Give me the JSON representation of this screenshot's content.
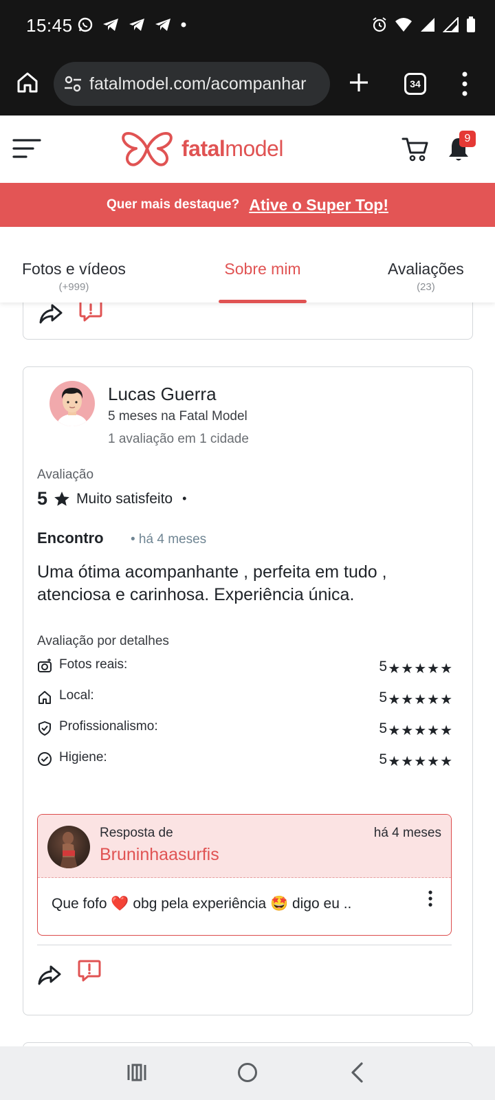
{
  "status_bar": {
    "time": "15:45"
  },
  "browser": {
    "url": "fatalmodel.com/acompanhar",
    "tab_count": "34"
  },
  "header": {
    "brand_bold": "fatal",
    "brand_light": "model",
    "notification_count": "9"
  },
  "promo": {
    "question": "Quer mais destaque?",
    "cta": "Ative o Super Top!"
  },
  "tabs": [
    {
      "label": "Fotos e vídeos",
      "count": "(+999)"
    },
    {
      "label": "Sobre mim",
      "count": ""
    },
    {
      "label": "Avaliações",
      "count": "(23)"
    }
  ],
  "active_tab": "Sobre mim",
  "review": {
    "user_name": "Lucas Guerra",
    "member_since": "5 meses na Fatal Model",
    "review_count": "1 avaliação em 1 cidade",
    "rating_label": "Avaliação",
    "rating_value": "5",
    "rating_star": "★",
    "rating_text": "Muito satisfeito",
    "dot": "•",
    "type": "Encontro",
    "time": "• há 4 meses",
    "text": "Uma ótima acompanhante , perfeita em tudo , atenciosa e carinhosa. Experiência única.",
    "details_title": "Avaliação por detalhes",
    "details": [
      {
        "icon": "camera-icon",
        "label": "Fotos reais:",
        "value": "5",
        "stars": "★★★★★"
      },
      {
        "icon": "house-icon",
        "label": "Local:",
        "value": "5",
        "stars": "★★★★★"
      },
      {
        "icon": "shield-check-icon",
        "label": "Profissionalismo:",
        "value": "5",
        "stars": "★★★★★"
      },
      {
        "icon": "check-circle-icon",
        "label": "Higiene:",
        "value": "5",
        "stars": "★★★★★"
      }
    ],
    "reply": {
      "from_label": "Resposta de",
      "user": "Bruninhaasurfis",
      "time": "há 4 meses",
      "text": "Que fofo ❤️ obg pela experiência 🤩 digo eu .."
    }
  },
  "colors": {
    "brand": "#e05353",
    "promo_bg": "#e35555",
    "reply_bg": "#fbe3e3",
    "status_bg": "#151515"
  }
}
